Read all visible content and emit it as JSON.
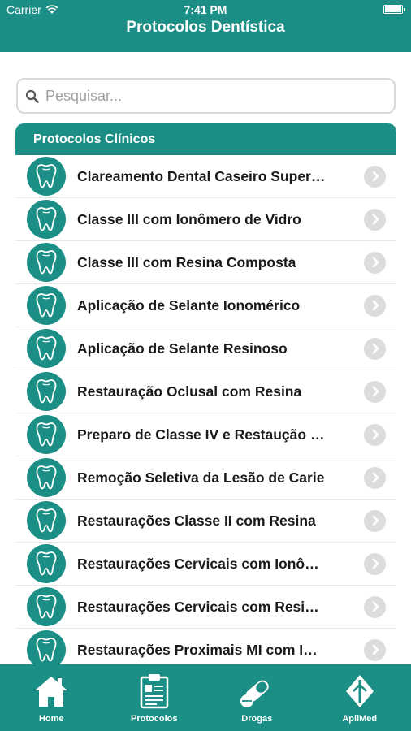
{
  "status_bar": {
    "carrier": "Carrier",
    "time": "7:41 PM"
  },
  "nav": {
    "title": "Protocolos Dentística"
  },
  "search": {
    "placeholder": "Pesquisar..."
  },
  "section": {
    "title": "Protocolos Clínicos",
    "items": [
      {
        "label": "Clareamento Dental Caseiro Super…"
      },
      {
        "label": "Classe III com Ionômero de Vidro"
      },
      {
        "label": "Classe III com Resina Composta"
      },
      {
        "label": "Aplicação de Selante Ionomérico"
      },
      {
        "label": "Aplicação de Selante Resinoso"
      },
      {
        "label": "Restauração Oclusal com Resina"
      },
      {
        "label": "Preparo de Classe IV e Restaução …"
      },
      {
        "label": "Remoção Seletiva da Lesão de Carie"
      },
      {
        "label": "Restaurações Classe II com Resina"
      },
      {
        "label": "Restaurações Cervicais com Ionô…"
      },
      {
        "label": "Restaurações Cervicais com Resi…"
      },
      {
        "label": "Restaurações Proximais MI com I…"
      }
    ]
  },
  "tabbar": {
    "tabs": [
      {
        "label": "Home",
        "icon": "home-icon"
      },
      {
        "label": "Protocolos",
        "icon": "clipboard-icon"
      },
      {
        "label": "Drogas",
        "icon": "pills-icon"
      },
      {
        "label": "ApliMed",
        "icon": "aplimed-logo-icon"
      }
    ]
  },
  "colors": {
    "primary": "#1b8f85",
    "chevron_bg": "#dcdcdc",
    "text": "#1a1a1a"
  }
}
